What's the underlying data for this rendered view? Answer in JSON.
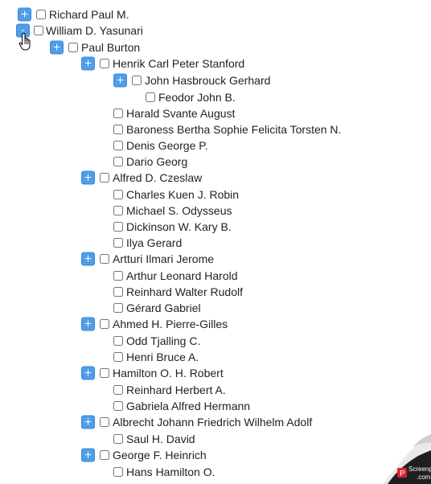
{
  "tree": [
    {
      "label": "Richard Paul M.",
      "level": 0,
      "toggle": "+"
    },
    {
      "label": "William D. Yasunari",
      "level": 0,
      "toggle": "-"
    },
    {
      "label": "Paul Burton",
      "level": 1,
      "toggle": "+"
    },
    {
      "label": "Henrik Carl Peter Stanford",
      "level": 2,
      "toggle": "+"
    },
    {
      "label": "John Hasbrouck Gerhard",
      "level": 3,
      "toggle": "+"
    },
    {
      "label": "Feodor John B.",
      "level": 4,
      "toggle": null
    },
    {
      "label": "Harald Svante August",
      "level": 3,
      "toggle": null
    },
    {
      "label": "Baroness Bertha Sophie Felicita Torsten N.",
      "level": 3,
      "toggle": null
    },
    {
      "label": "Denis George P.",
      "level": 3,
      "toggle": null
    },
    {
      "label": "Dario Georg",
      "level": 3,
      "toggle": null
    },
    {
      "label": "Alfred D. Czeslaw",
      "level": 2,
      "toggle": "+"
    },
    {
      "label": "Charles Kuen J. Robin",
      "level": 3,
      "toggle": null
    },
    {
      "label": "Michael S. Odysseus",
      "level": 3,
      "toggle": null
    },
    {
      "label": "Dickinson W. Kary B.",
      "level": 3,
      "toggle": null
    },
    {
      "label": "Ilya Gerard",
      "level": 3,
      "toggle": null
    },
    {
      "label": "Artturi Ilmari Jerome",
      "level": 2,
      "toggle": "+"
    },
    {
      "label": "Arthur Leonard Harold",
      "level": 3,
      "toggle": null
    },
    {
      "label": "Reinhard Walter Rudolf",
      "level": 3,
      "toggle": null
    },
    {
      "label": "Gérard Gabriel",
      "level": 3,
      "toggle": null
    },
    {
      "label": "Ahmed H. Pierre-Gilles",
      "level": 2,
      "toggle": "+"
    },
    {
      "label": "Odd Tjalling C.",
      "level": 3,
      "toggle": null
    },
    {
      "label": "Henri Bruce A.",
      "level": 3,
      "toggle": null
    },
    {
      "label": "Hamilton O. H. Robert",
      "level": 2,
      "toggle": "+"
    },
    {
      "label": "Reinhard Herbert A.",
      "level": 3,
      "toggle": null
    },
    {
      "label": "Gabriela Alfred Hermann",
      "level": 3,
      "toggle": null
    },
    {
      "label": "Albrecht Johann Friedrich Wilhelm Adolf",
      "level": 2,
      "toggle": "+"
    },
    {
      "label": "Saul H. David",
      "level": 3,
      "toggle": null
    },
    {
      "label": "George F. Heinrich",
      "level": 2,
      "toggle": "+"
    },
    {
      "label": "Hans Hamilton O.",
      "level": 3,
      "toggle": null
    }
  ],
  "watermark": {
    "brand": "Screenpresso",
    "domain": ".com"
  },
  "colors": {
    "toggle_bg": "#4f9ee8",
    "toggle_border": "#3b87d4",
    "watermark_red": "#d9232f"
  }
}
